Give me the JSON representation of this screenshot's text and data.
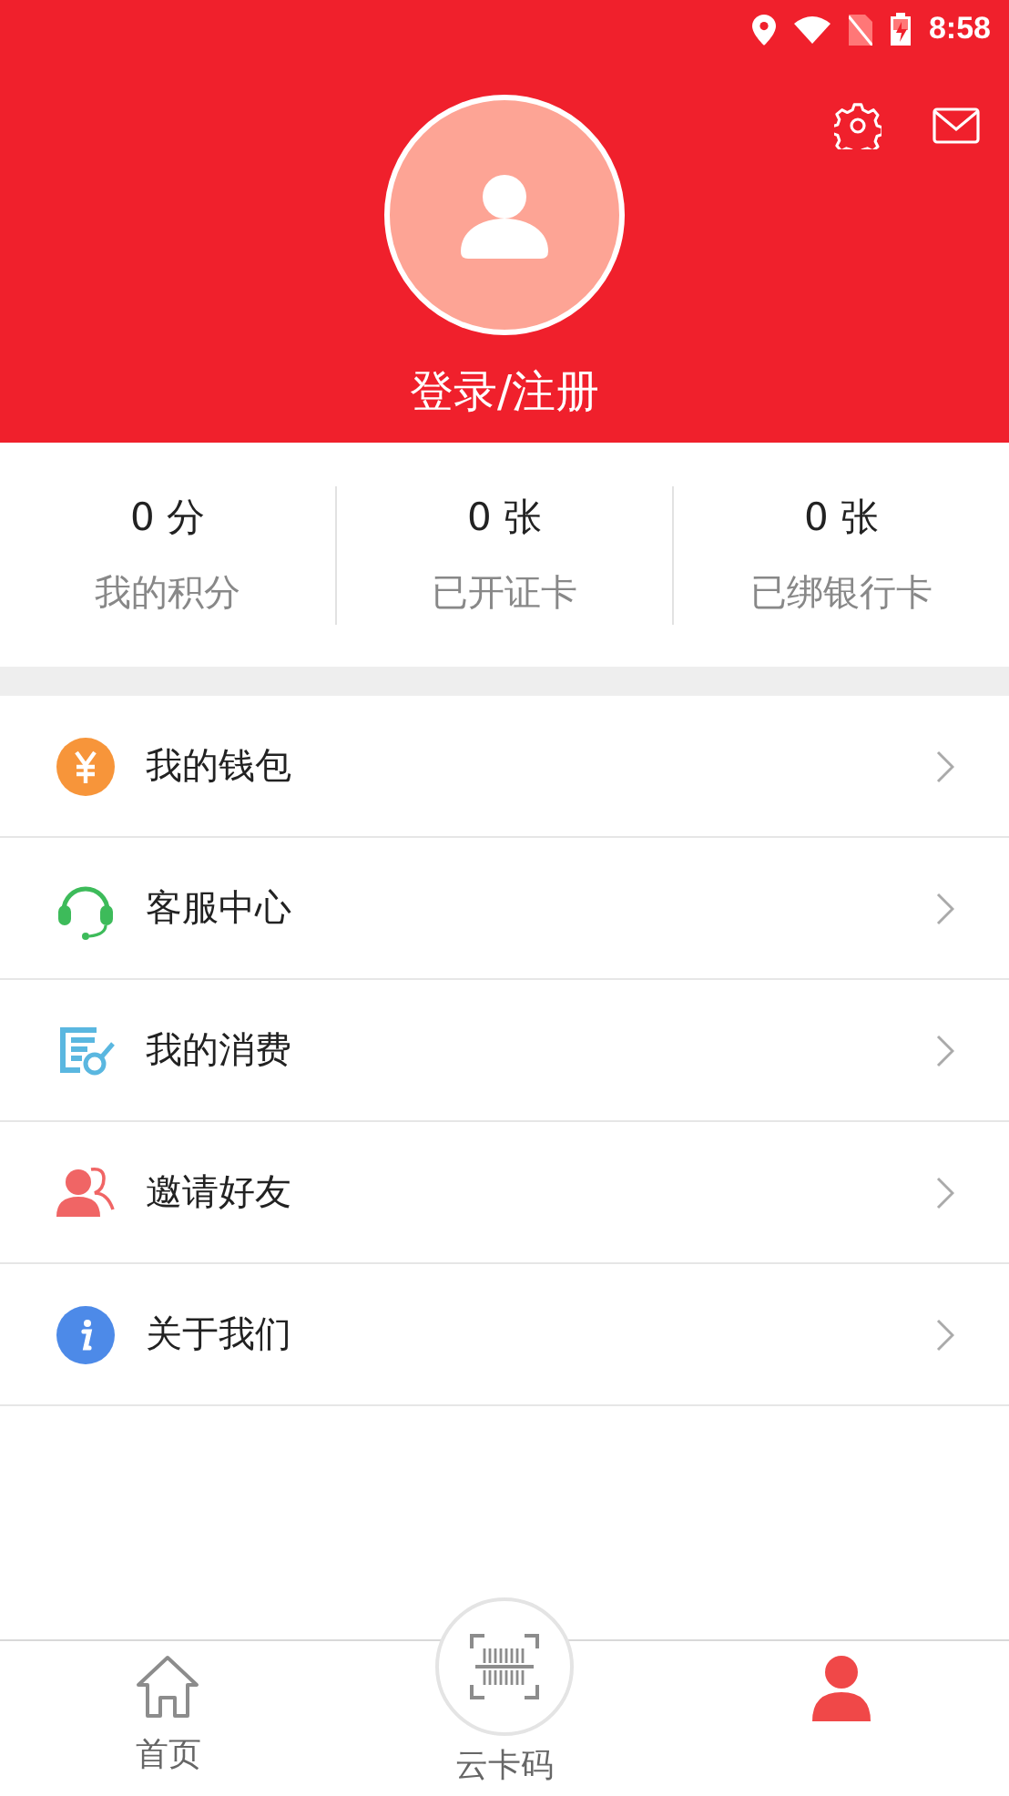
{
  "status_bar": {
    "time": "8:58"
  },
  "header": {
    "login": "登录/注册"
  },
  "stats": [
    {
      "value": "0 分",
      "label": "我的积分"
    },
    {
      "value": "0 张",
      "label": "已开证卡"
    },
    {
      "value": "0 张",
      "label": "已绑银行卡"
    }
  ],
  "menu": [
    {
      "kind": "wallet",
      "label": "我的钱包"
    },
    {
      "kind": "service",
      "label": "客服中心"
    },
    {
      "kind": "consume",
      "label": "我的消费"
    },
    {
      "kind": "invite",
      "label": "邀请好友"
    },
    {
      "kind": "about",
      "label": "关于我们"
    }
  ],
  "tabs": [
    {
      "kind": "home",
      "label": "首页",
      "selected": false
    },
    {
      "kind": "scan",
      "label": "云卡码",
      "selected": false
    },
    {
      "kind": "me",
      "selected": true
    }
  ]
}
